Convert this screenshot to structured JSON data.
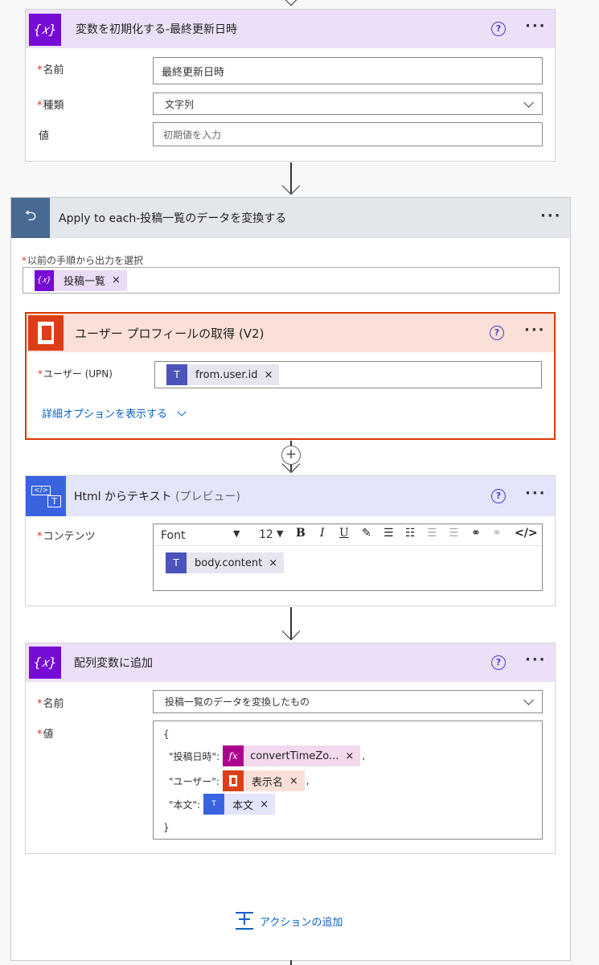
{
  "init_var": {
    "title": "変数を初期化する-最終更新日時",
    "name_label": "名前",
    "name_value": "最終更新日時",
    "type_label": "種類",
    "type_value": "文字列",
    "value_label": "値",
    "value_placeholder": "初期値を入力"
  },
  "apply_each": {
    "title": "Apply to each-投稿一覧のデータを変換する",
    "select_label": "以前の手順から出力を選択",
    "token": "投稿一覧"
  },
  "profile": {
    "title": "ユーザー プロフィールの取得 (V2)",
    "user_label": "ユーザー (UPN)",
    "token": "from.user.id",
    "advanced": "詳細オプションを表示する"
  },
  "html_text": {
    "title": "Html からテキスト",
    "title_sub": "(プレビュー)",
    "content_label": "コンテンツ",
    "font": "Font",
    "font_size": "12",
    "token": "body.content"
  },
  "append": {
    "title": "配列変数に追加",
    "name_label": "名前",
    "name_value": "投稿一覧のデータを変換したもの",
    "value_label": "値",
    "brace_open": "{",
    "line1_key": "\"投稿日時\":",
    "line1_token": "convertTimeZo...",
    "line2_key": "\"ユーザー\":",
    "line2_token": "表示名",
    "line3_key": "\"本文\":",
    "line3_token": "本文",
    "comma": ",",
    "brace_close": "}"
  },
  "add_action": "アクションの追加",
  "colors": {
    "variable": "#770bd6",
    "office": "#dc3e15",
    "teams": "#4b53bc",
    "html": "#3a63e0",
    "loop": "#486991",
    "expression": "#ad008c"
  }
}
